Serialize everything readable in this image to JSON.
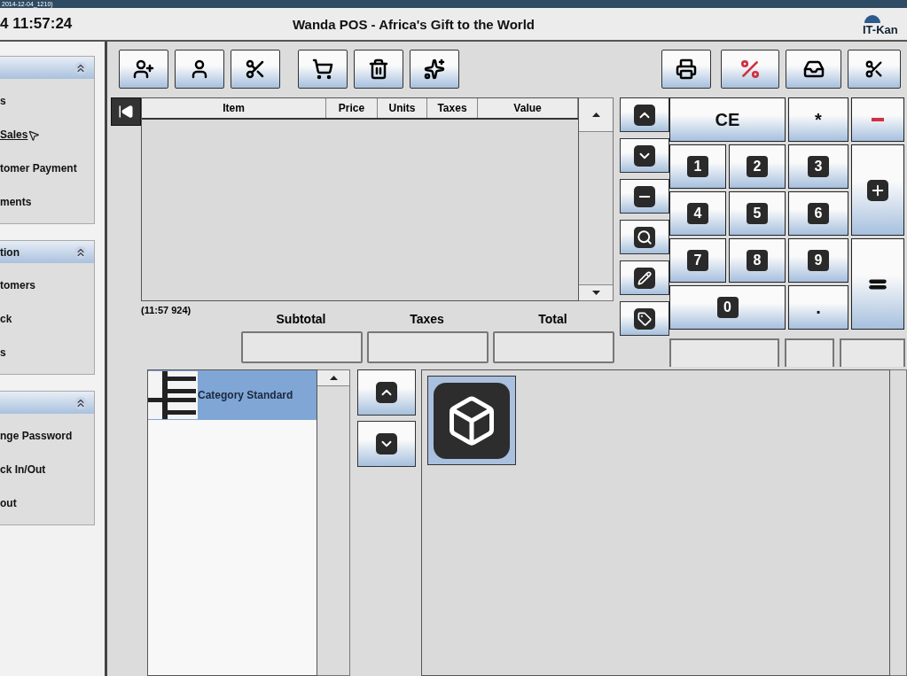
{
  "capture_label": "2014-12-04_1210)",
  "header": {
    "clock": "4 11:57:24",
    "title": "Wanda POS - Africa's Gift to the World",
    "logo": "IT-Kan"
  },
  "sidebar": {
    "sections": [
      {
        "items": [
          {
            "label": "s",
            "hovered": false
          },
          {
            "label": "Sales",
            "hovered": true
          },
          {
            "label": "tomer Payment",
            "hovered": false
          },
          {
            "label": "ments",
            "hovered": false
          }
        ]
      },
      {
        "title": "tion",
        "items": [
          {
            "label": "tomers",
            "hovered": false
          },
          {
            "label": "ck",
            "hovered": false
          },
          {
            "label": "s",
            "hovered": false
          }
        ]
      },
      {
        "items": [
          {
            "label": "nge Password",
            "hovered": false
          },
          {
            "label": "ck In/Out",
            "hovered": false
          },
          {
            "label": "out",
            "hovered": false
          }
        ]
      }
    ]
  },
  "ticket": {
    "columns": [
      "Item",
      "Price",
      "Units",
      "Taxes",
      "Value"
    ],
    "status": "(11:57 924)",
    "totals": [
      "Subtotal",
      "Taxes",
      "Total"
    ]
  },
  "keypad": [
    {
      "kind": "text",
      "label": "CE"
    },
    {
      "kind": "text",
      "label": "*"
    },
    {
      "kind": "minus"
    },
    {
      "kind": "digit",
      "label": "1"
    },
    {
      "kind": "digit",
      "label": "2"
    },
    {
      "kind": "digit",
      "label": "3"
    },
    {
      "kind": "plus"
    },
    {
      "kind": "digit",
      "label": "4"
    },
    {
      "kind": "digit",
      "label": "5"
    },
    {
      "kind": "digit",
      "label": "6"
    },
    {
      "kind": "digit",
      "label": "7"
    },
    {
      "kind": "digit",
      "label": "8"
    },
    {
      "kind": "digit",
      "label": "9"
    },
    {
      "kind": "equals"
    },
    {
      "kind": "digit",
      "label": "0"
    },
    {
      "kind": "text",
      "label": "."
    }
  ],
  "categories": [
    {
      "label": "Category Standard",
      "selected": true
    }
  ]
}
